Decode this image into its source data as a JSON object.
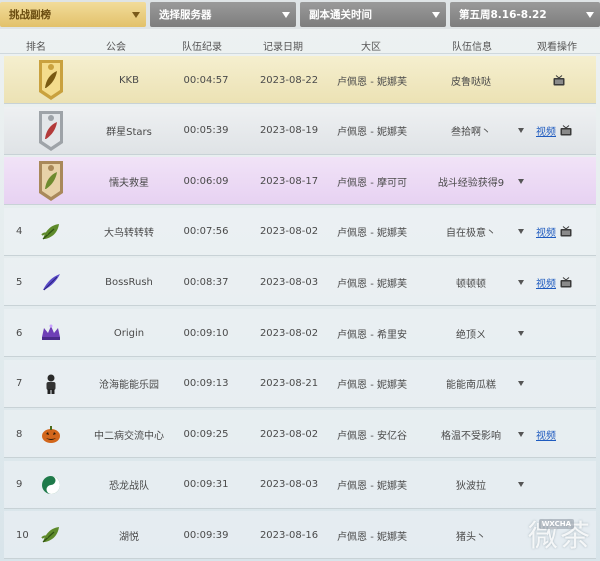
{
  "filters": [
    {
      "label": "挑战副榜"
    },
    {
      "label": "选择服务器"
    },
    {
      "label": "副本通关时间"
    },
    {
      "label": "第五周8.16-8.22"
    }
  ],
  "columns": {
    "rank": "排名",
    "guild": "公会",
    "record": "队伍纪录",
    "date": "记录日期",
    "area": "大区",
    "info": "队伍信息",
    "ops": "观看操作"
  },
  "rows": [
    {
      "rank": "",
      "icon": "gold-medal-icon",
      "guild": "KKB",
      "time": "00:04:57",
      "date": "2023-08-22",
      "area": "卢佩恩 - 妮娜芙",
      "info": "皮鲁哒哒",
      "caret": false,
      "video": "",
      "tv": true
    },
    {
      "rank": "",
      "icon": "silver-medal-icon",
      "guild": "群星Stars",
      "time": "00:05:39",
      "date": "2023-08-19",
      "area": "卢佩恩 - 妮娜芙",
      "info": "叁拾啊丶",
      "caret": true,
      "video": "视频",
      "tv": true
    },
    {
      "rank": "",
      "icon": "bronze-medal-icon",
      "guild": "懦夫救星",
      "time": "00:06:09",
      "date": "2023-08-17",
      "area": "卢佩恩 - 摩可可",
      "info": "战斗经验获得9",
      "caret": true,
      "video": "",
      "tv": false
    },
    {
      "rank": "4",
      "icon": "green-leaf-icon",
      "guild": "大鸟转转转",
      "time": "00:07:56",
      "date": "2023-08-02",
      "area": "卢佩恩 - 妮娜芙",
      "info": "自在极意丶",
      "caret": true,
      "video": "视频",
      "tv": true
    },
    {
      "rank": "5",
      "icon": "purple-feather-icon",
      "guild": "BossRush",
      "time": "00:08:37",
      "date": "2023-08-03",
      "area": "卢佩恩 - 妮娜芙",
      "info": "顿顿顿",
      "caret": true,
      "video": "视频",
      "tv": true
    },
    {
      "rank": "6",
      "icon": "crown-icon",
      "guild": "Origin",
      "time": "00:09:10",
      "date": "2023-08-02",
      "area": "卢佩恩 - 希里安",
      "info": "绝顶ㄨ",
      "caret": true,
      "video": "",
      "tv": false
    },
    {
      "rank": "7",
      "icon": "black-figure-icon",
      "guild": "沧海能能乐园",
      "time": "00:09:13",
      "date": "2023-08-21",
      "area": "卢佩恩 - 妮娜芙",
      "info": "能能南瓜糕",
      "caret": true,
      "video": "",
      "tv": false
    },
    {
      "rank": "8",
      "icon": "pumpkin-icon",
      "guild": "中二病交流中心",
      "time": "00:09:25",
      "date": "2023-08-02",
      "area": "卢佩恩 - 安亿谷",
      "info": "格温不受影响",
      "caret": true,
      "video": "视频",
      "tv": false
    },
    {
      "rank": "9",
      "icon": "yin-yang-icon",
      "guild": "恐龙战队",
      "time": "00:09:31",
      "date": "2023-08-03",
      "area": "卢佩恩 - 妮娜芙",
      "info": "狄波拉",
      "caret": true,
      "video": "",
      "tv": false
    },
    {
      "rank": "10",
      "icon": "green-leaf-icon",
      "guild": "湖悦",
      "time": "00:09:39",
      "date": "2023-08-16",
      "area": "卢佩恩 - 妮娜芙",
      "info": "猪头丶",
      "caret": false,
      "video": "",
      "tv": false
    }
  ],
  "watermark": {
    "main": "微茶",
    "sub": "WXCHA"
  },
  "colors": {
    "gold": "#e2c16a",
    "link": "#1f5bbf",
    "filter_gray": "#8a8a8a"
  }
}
